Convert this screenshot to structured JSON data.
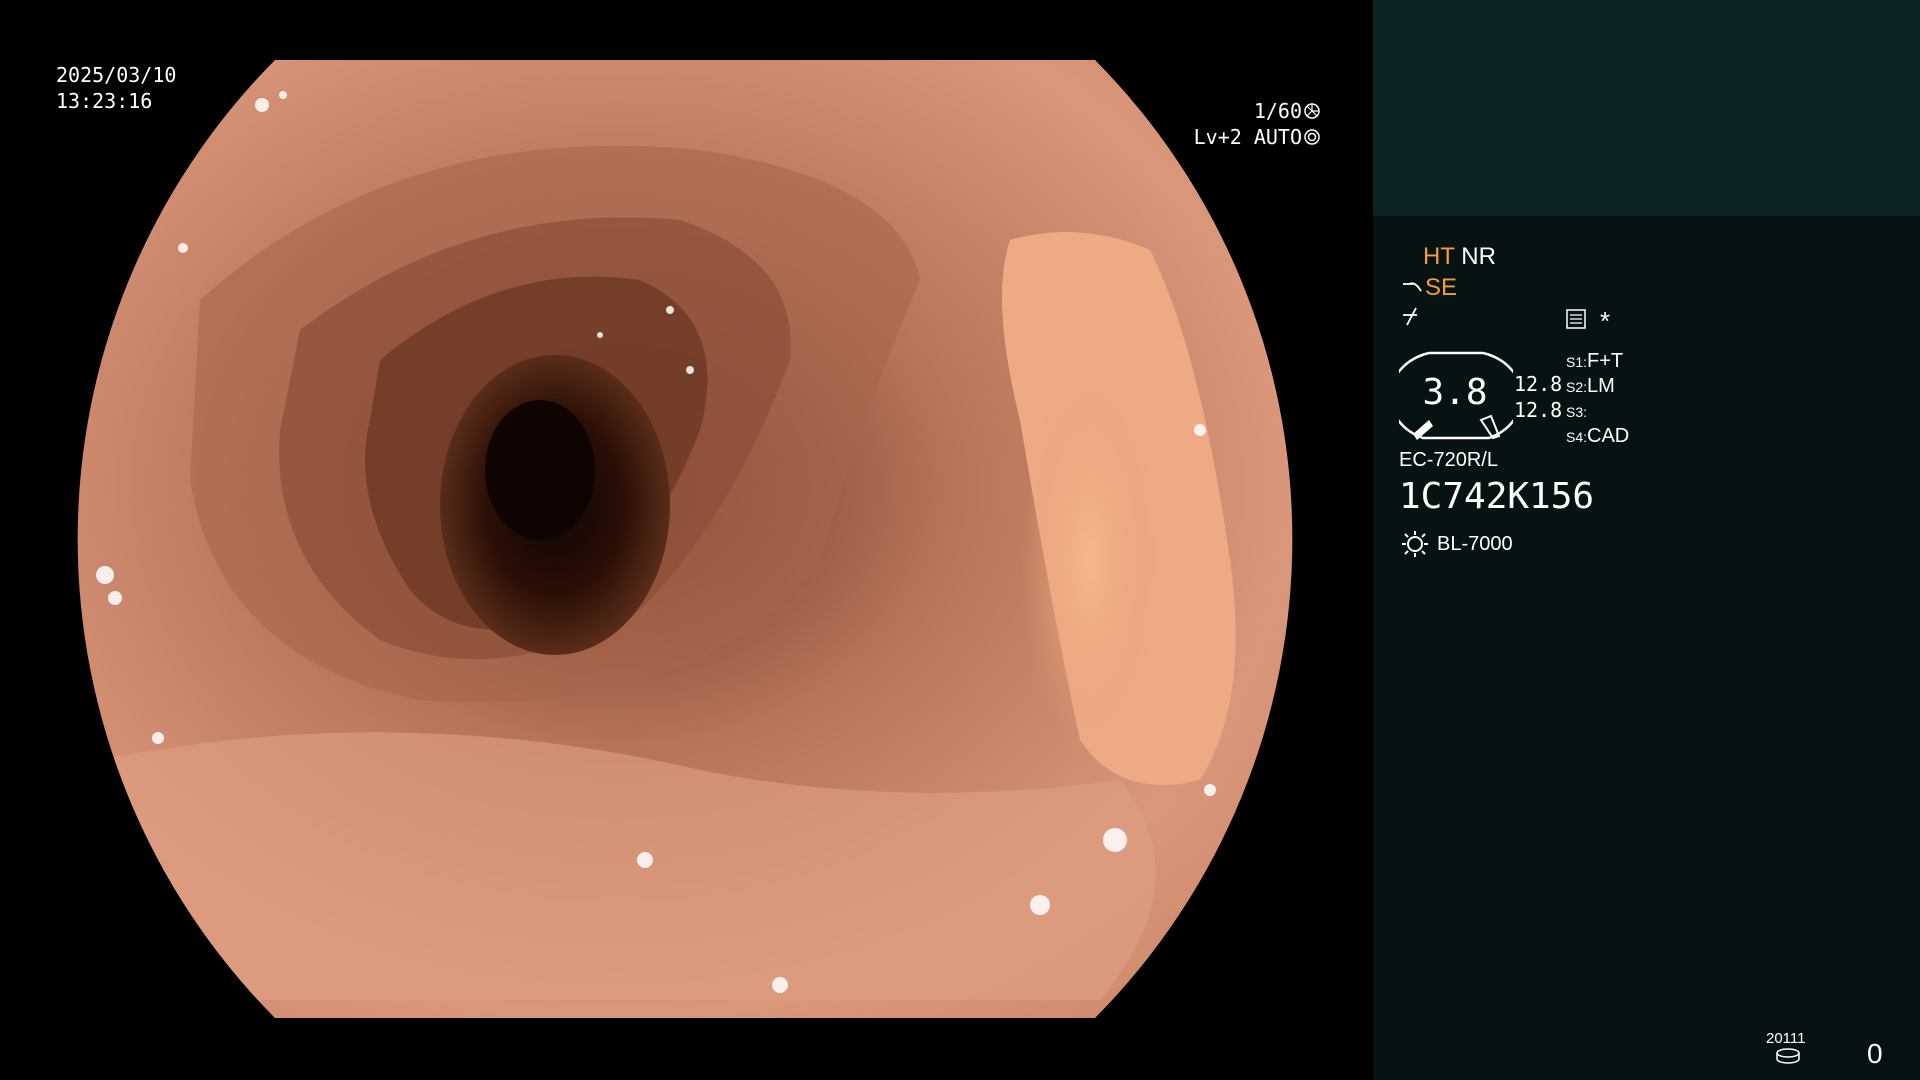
{
  "overlay": {
    "date": "2025/03/10",
    "time": "13:23:16",
    "shutter": "1/60",
    "level_auto": "Lv+2 AUTO"
  },
  "panel": {
    "mode_ht": "HT",
    "mode_nr": "NR",
    "mode_se": "SE",
    "star": "*",
    "gauge_value": "3.8",
    "pressure_1": "12.8",
    "pressure_2": "12.8",
    "switches": [
      {
        "key": "S1:",
        "value": "F+T"
      },
      {
        "key": "S2:",
        "value": "LM"
      },
      {
        "key": "S3:",
        "value": ""
      },
      {
        "key": "S4:",
        "value": "CAD"
      }
    ],
    "scope_model": "EC-720R/L",
    "scope_serial": "1C742K156",
    "light_source": "BL-7000",
    "record_code": "20111",
    "counter": "0"
  },
  "colors": {
    "panel_bg": "#071212",
    "panel_top_bg": "#0c2426",
    "highlight_orange": "#f0a030",
    "mucosa": "#d9937a"
  },
  "icons": [
    "shutter-icon",
    "iris-icon",
    "scope-icon",
    "structure-icon",
    "memo-icon",
    "light-icon",
    "disk-icon"
  ]
}
